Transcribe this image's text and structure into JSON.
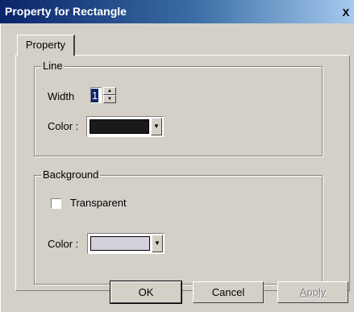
{
  "window": {
    "title": "Property for Rectangle",
    "close_glyph": "X"
  },
  "tabs": [
    {
      "label": "Property"
    }
  ],
  "line_group": {
    "legend": "Line",
    "width_label": "Width",
    "width_value": "1",
    "color_label": "Color :",
    "color_value": "#1a1a1a"
  },
  "background_group": {
    "legend": "Background",
    "transparent_label": "Transparent",
    "transparent_checked": false,
    "color_label": "Color :",
    "color_value": "#d4d0dc"
  },
  "buttons": {
    "ok": "OK",
    "cancel": "Cancel",
    "apply": "Apply"
  }
}
